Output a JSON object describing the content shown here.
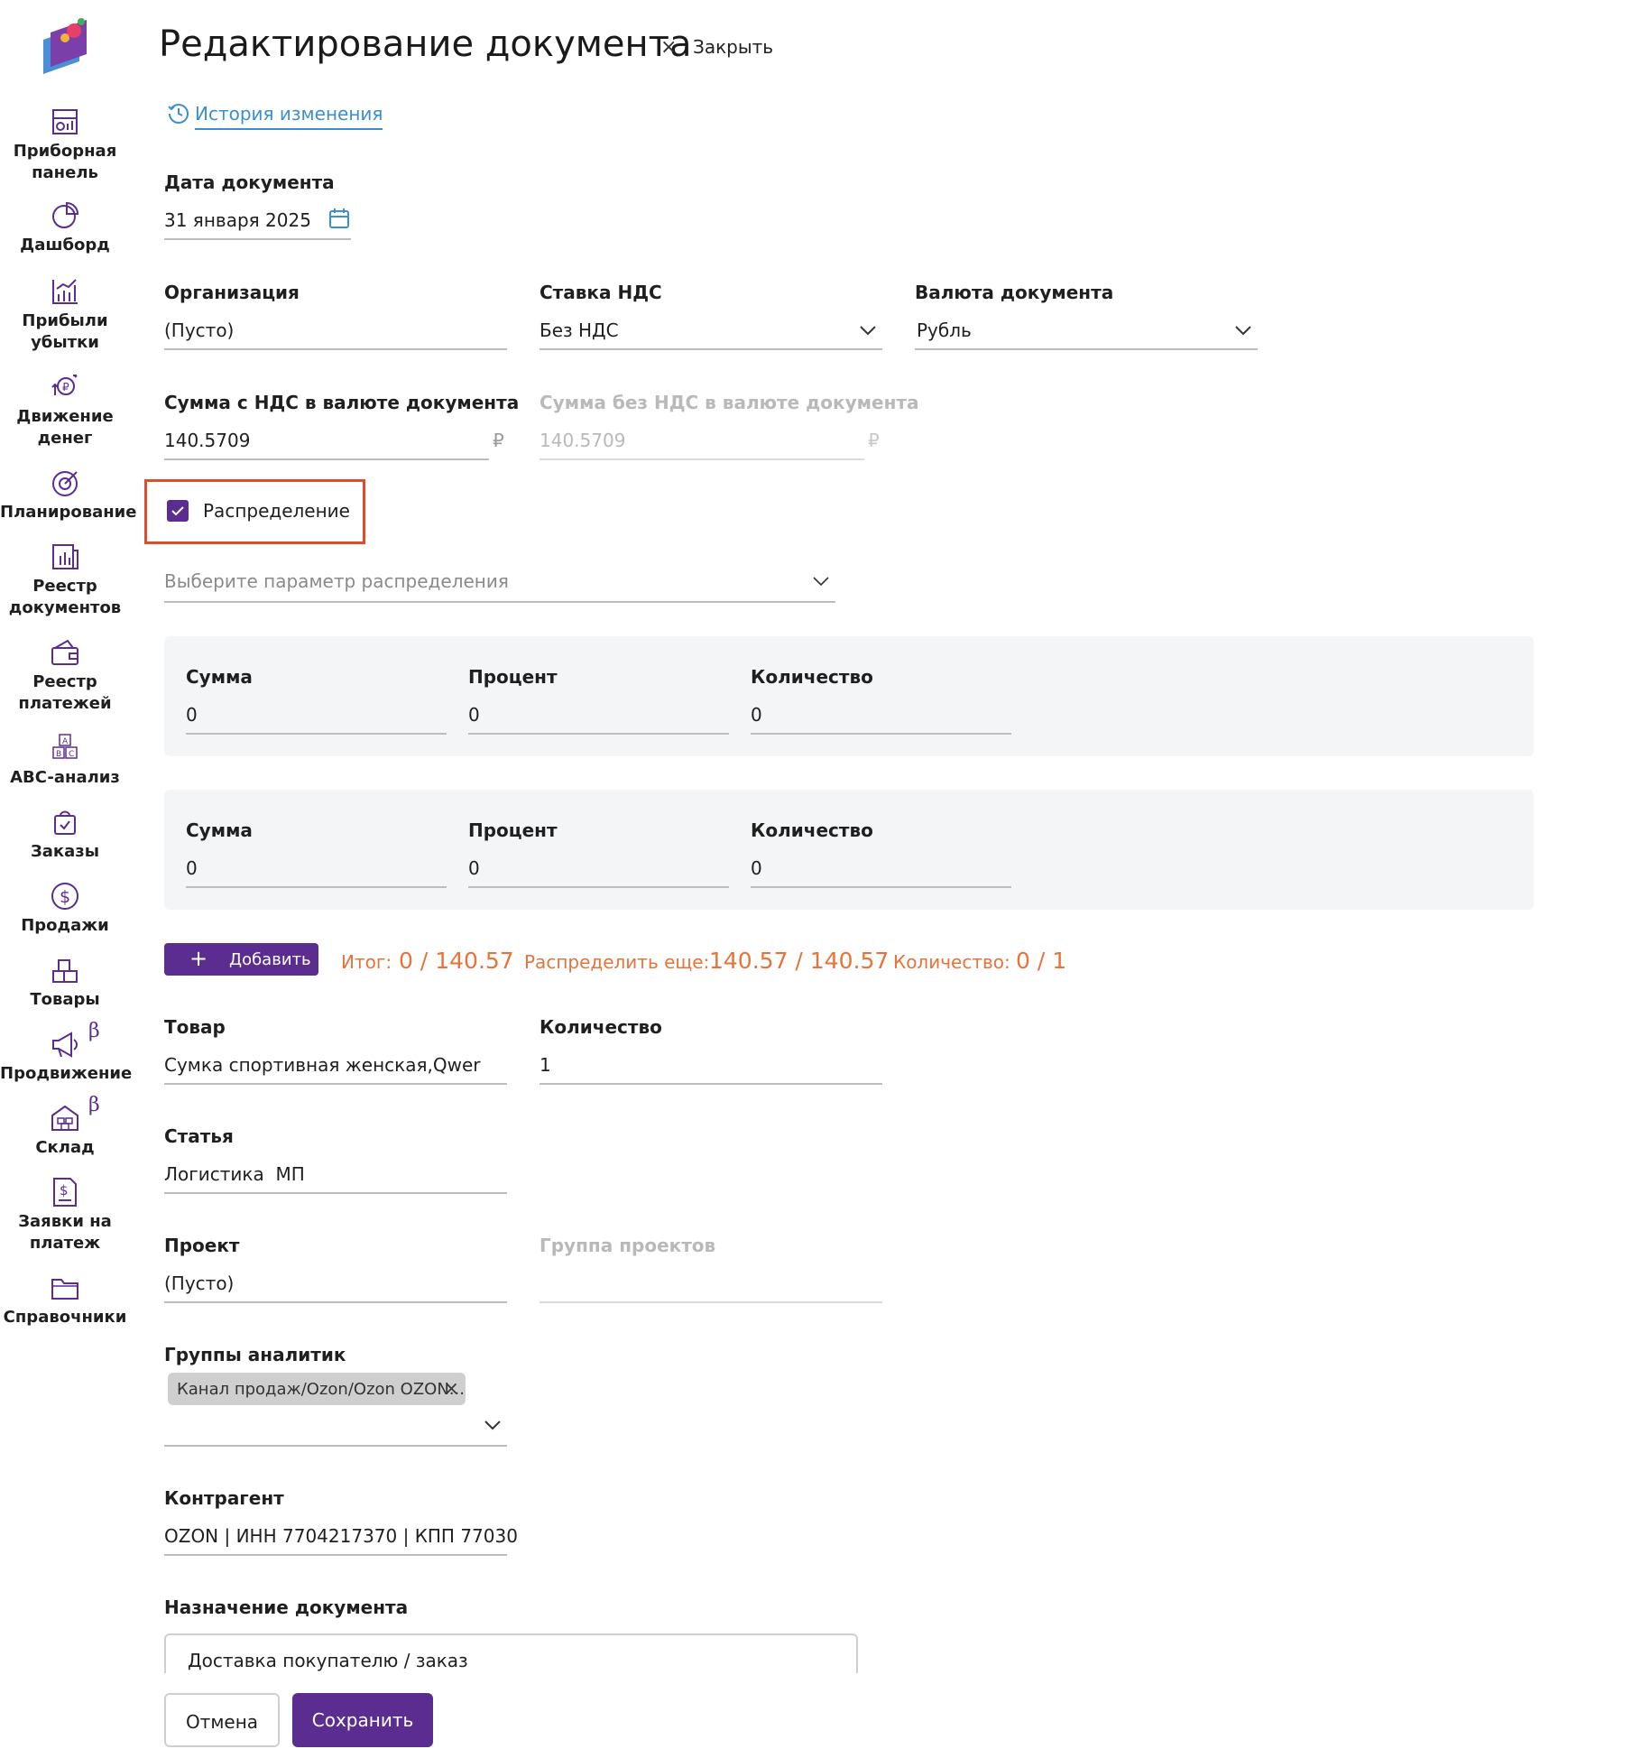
{
  "sidebar": {
    "items": [
      {
        "label": "Приборная\nпанель",
        "icon": "dashboard-panel-icon"
      },
      {
        "label": "Дашборд",
        "icon": "pie-chart-icon"
      },
      {
        "label": "Прибыли\nубытки",
        "icon": "bar-chart-icon"
      },
      {
        "label": "Движение\nденег",
        "icon": "money-flow-icon"
      },
      {
        "label": "Планирование",
        "icon": "target-icon"
      },
      {
        "label": "Реестр\nдокументов",
        "icon": "documents-icon"
      },
      {
        "label": "Реестр\nплатежей",
        "icon": "wallet-icon"
      },
      {
        "label": "ABC-анализ",
        "icon": "abc-icon"
      },
      {
        "label": "Заказы",
        "icon": "shopping-bag-icon"
      },
      {
        "label": "Продажи",
        "icon": "dollar-circle-icon"
      },
      {
        "label": "Товары",
        "icon": "boxes-icon"
      },
      {
        "label": "Продвижение",
        "icon": "megaphone-icon"
      },
      {
        "label": "Склад",
        "icon": "warehouse-icon"
      },
      {
        "label": "Заявки на\nплатеж",
        "icon": "payment-request-icon"
      },
      {
        "label": "Справочники",
        "icon": "folder-icon"
      }
    ],
    "beta_mark": "β"
  },
  "header": {
    "title": "Редактирование документа",
    "close_icon": "×",
    "close_label": "Закрыть",
    "history_link": "История изменения"
  },
  "form": {
    "doc_date_label": "Дата документа",
    "doc_date_value": "31 января 2025",
    "org_label": "Организация",
    "org_value": "(Пусто)",
    "vat_label": "Ставка НДС",
    "vat_value": "Без НДС",
    "currency_label": "Валюта документа",
    "currency_value": "Рубль",
    "sum_vat_label": "Сумма с НДС в валюте документа",
    "sum_vat_value": "140.5709",
    "sum_novat_label": "Сумма без НДС в валюте документа",
    "sum_novat_value": "140.5709",
    "currency_sign": "₽",
    "distribution_label": "Распределение",
    "distribution_checked": true,
    "distribution_param_placeholder": "Выберите параметр распределения",
    "rows": [
      {
        "sum_label": "Сумма",
        "sum_value": "0",
        "percent_label": "Процент",
        "percent_value": "0",
        "qty_label": "Количество",
        "qty_value": "0"
      },
      {
        "sum_label": "Сумма",
        "sum_value": "0",
        "percent_label": "Процент",
        "percent_value": "0",
        "qty_label": "Количество",
        "qty_value": "0"
      }
    ],
    "add_button": "Добавить",
    "add_plus": "+",
    "totals": {
      "total_label": "Итог:",
      "total_value": "0 / 140.57",
      "remaining_label": "Распределить еще:",
      "remaining_value": "140.57 / 140.57",
      "qty_label": "Количество:",
      "qty_value": "0 / 1"
    },
    "product_label": "Товар",
    "product_value": "Сумка спортивная женская,Qwer",
    "product_qty_label": "Количество",
    "product_qty_value": "1",
    "article_label": "Статья",
    "article_value": "Логистика  МП",
    "project_label": "Проект",
    "project_value": "(Пусто)",
    "project_group_label": "Группа проектов",
    "analytics_label": "Группы аналитик",
    "analytics_chip": "Канал продаж/Ozon/Ozon OZON...",
    "chip_close": "×",
    "counterparty_label": "Контрагент",
    "counterparty_value": "OZON | ИНН 7704217370 | КПП 77030",
    "purpose_label": "Назначение документа",
    "purpose_value": "Доставка покупателю / заказ"
  },
  "footer": {
    "cancel": "Отмена",
    "save": "Сохранить"
  },
  "colors": {
    "brand": "#5c2d91",
    "accent_orange": "#e8733a",
    "link_blue": "#3a8fd1",
    "highlight_red": "#e04a2f"
  }
}
